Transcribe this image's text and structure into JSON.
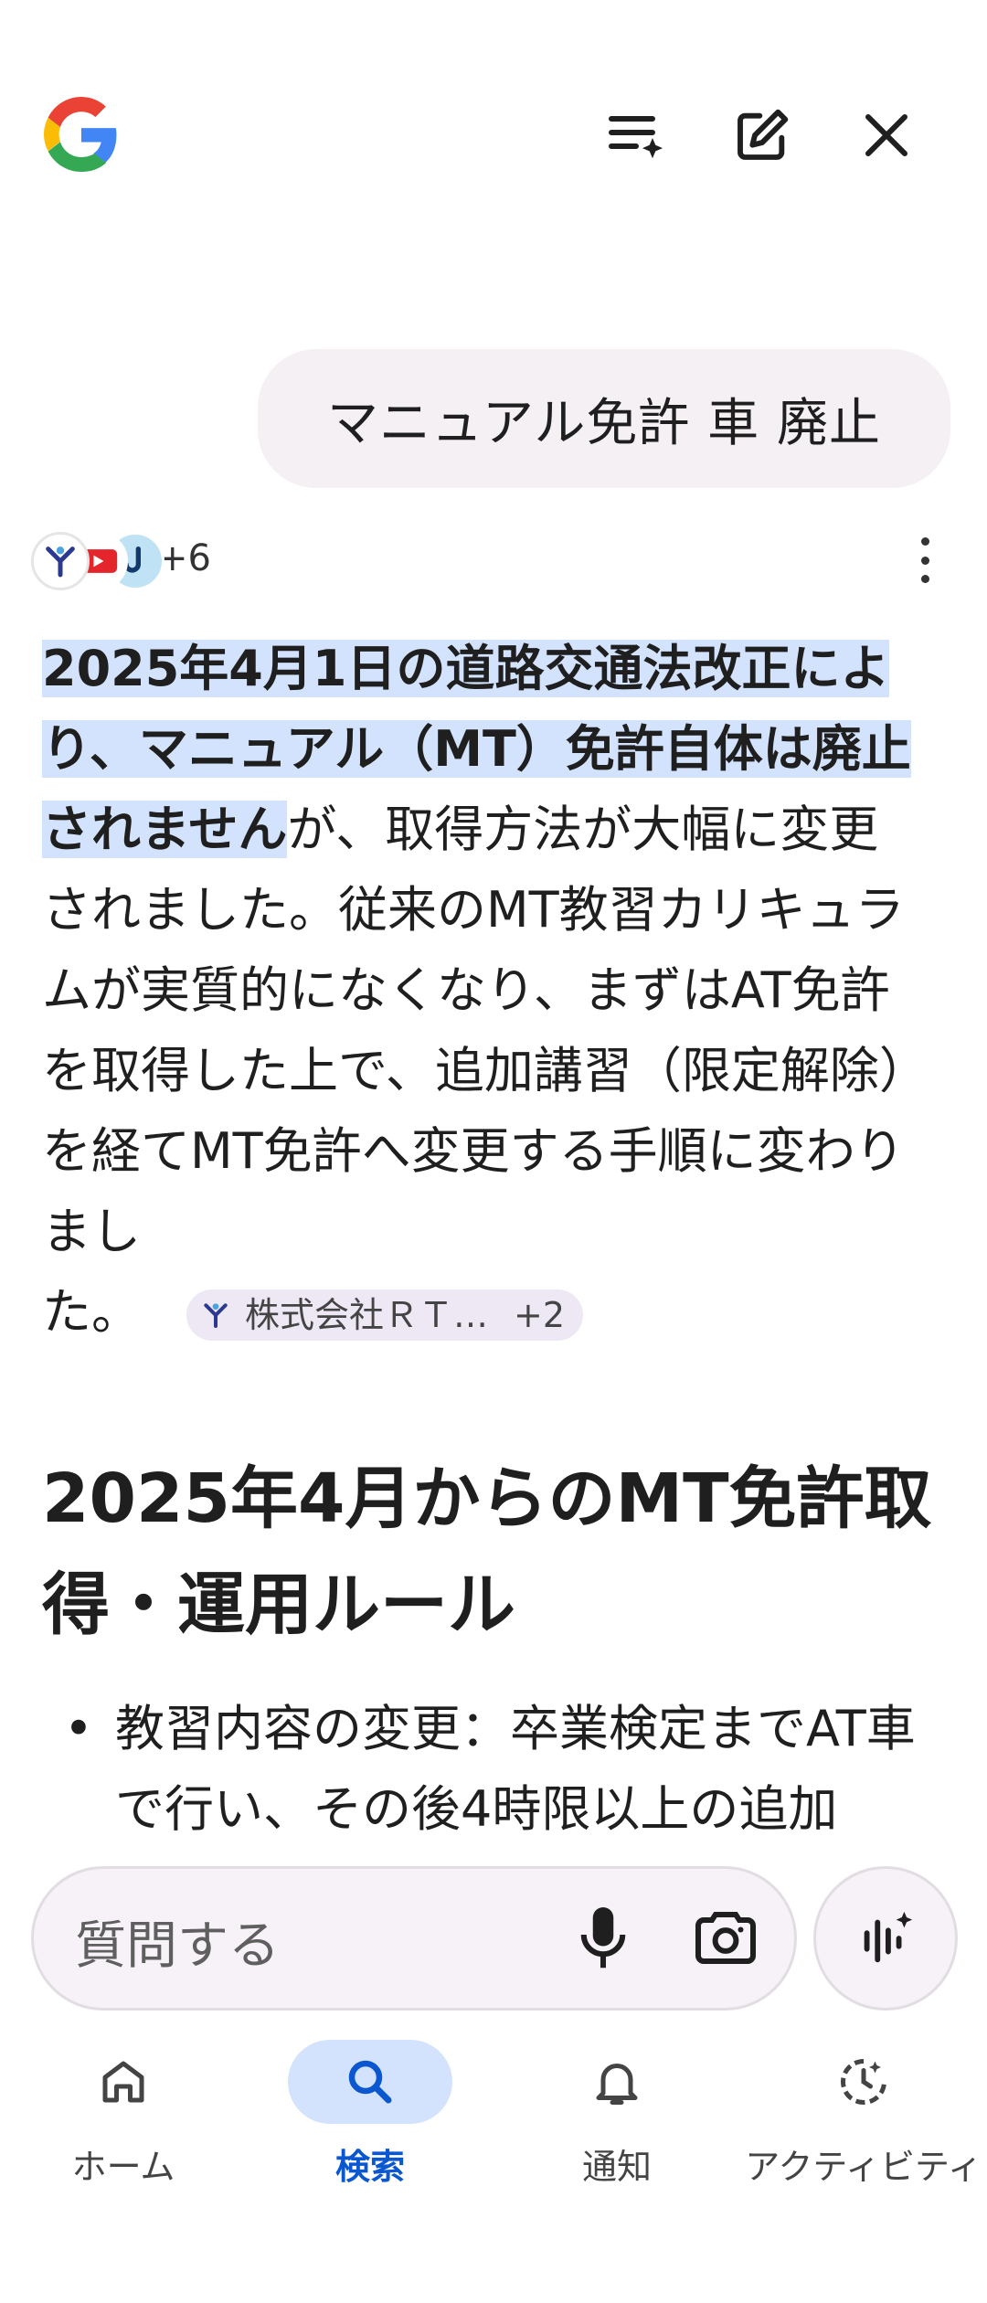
{
  "header": {
    "logo": "google-g-logo",
    "icons": [
      "history-sparkle-icon",
      "new-chat-icon",
      "close-icon"
    ]
  },
  "query": {
    "text": "マニュアル免許 車 廃止"
  },
  "sources": {
    "more_count": "+6"
  },
  "answer": {
    "highlight": "2025年4月1日の道路交通法改正により、マニュアル（MT）免許自体は廃止されません",
    "rest": "が、取得方法が大幅に変更されました。従来のMT教習カリキュラムが実質的になくなり、まずはAT免許を取得した上で、追加講習（限定解除）を経てMT免許へ変更する手順に変わりまし",
    "end": "た。",
    "citation_chip": {
      "label": "株式会社ＲＴ…",
      "count": "+2"
    }
  },
  "section": {
    "heading": "2025年4月からのMT免許取得・運用ルール",
    "bullet": "教習内容の変更：卒業検定までAT車で行い、その後4時限以上の追加"
  },
  "ask": {
    "placeholder": "質問する"
  },
  "nav": {
    "items": [
      {
        "label": "ホーム",
        "icon": "home-icon"
      },
      {
        "label": "検索",
        "icon": "search-icon",
        "active": true
      },
      {
        "label": "通知",
        "icon": "bell-icon"
      },
      {
        "label": "アクティビティ",
        "icon": "activity-icon"
      }
    ]
  },
  "colors": {
    "highlight": "#d3e3fd",
    "active_blue": "#0b57d0",
    "bubble": "#f4f0f4",
    "chip": "#ede8f4"
  }
}
